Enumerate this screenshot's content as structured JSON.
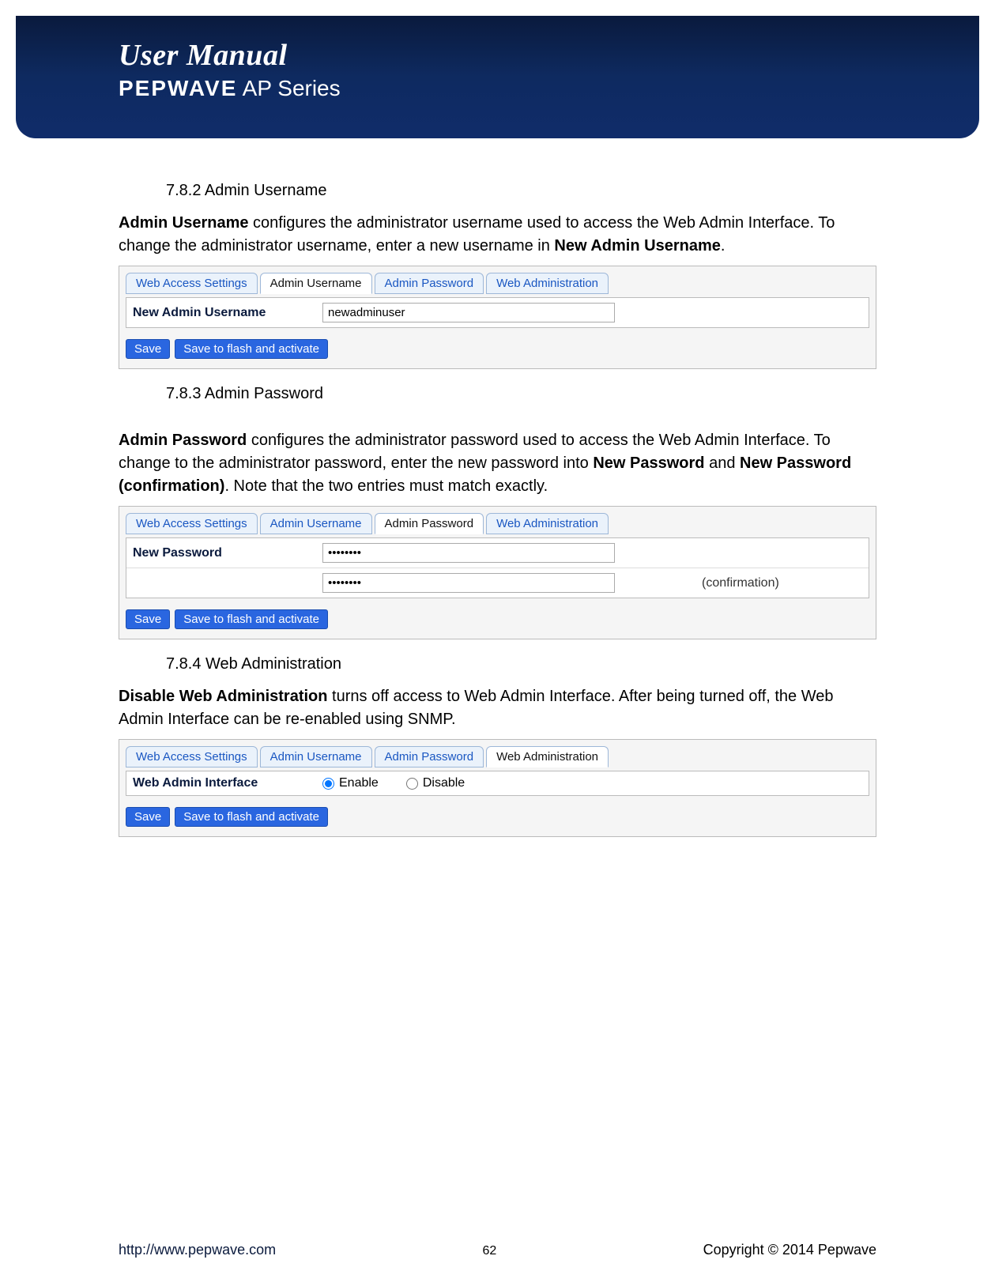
{
  "header": {
    "title": "User Manual",
    "brand": "PEPWAVE",
    "series": " AP Series"
  },
  "sections": {
    "s782": {
      "heading": "7.8.2 Admin Username",
      "para_prefix": "Admin Username",
      "para_mid1": " configures the administrator username used to access the Web Admin Interface. To change the administrator username, enter a new username in ",
      "para_bold2": "New Admin Username",
      "para_end": "."
    },
    "panel1": {
      "tabs": [
        "Web Access Settings",
        "Admin Username",
        "Admin Password",
        "Web Administration"
      ],
      "active": 1,
      "row_label": "New Admin Username",
      "row_value": "newadminuser",
      "save": "Save",
      "save_flash": "Save to flash and activate"
    },
    "s783": {
      "heading": "7.8.3 Admin Password",
      "para_prefix": "Admin Password",
      "para_mid1": " configures the administrator password used to access the Web Admin Interface. To change to the administrator password, enter the new password into ",
      "para_bold2": "New Password",
      "para_mid2": " and ",
      "para_bold3": "New Password (confirmation)",
      "para_end": ". Note that the two entries must match exactly."
    },
    "panel2": {
      "tabs": [
        "Web Access Settings",
        "Admin Username",
        "Admin Password",
        "Web Administration"
      ],
      "active": 2,
      "row_label": "New Password",
      "pw1": "••••••••",
      "pw2": "••••••••",
      "confirm_suffix": "(confirmation)",
      "save": "Save",
      "save_flash": "Save to flash and activate"
    },
    "s784": {
      "heading": "7.8.4   Web Administration",
      "para_prefix": "Disable Web Administration",
      "para_rest": " turns off access to Web Admin Interface. After being turned off, the Web Admin Interface can be re-enabled using SNMP."
    },
    "panel3": {
      "tabs": [
        "Web Access Settings",
        "Admin Username",
        "Admin Password",
        "Web Administration"
      ],
      "active": 3,
      "row_label": "Web Admin Interface",
      "opt_enable": "Enable",
      "opt_disable": "Disable",
      "enabled_checked": true,
      "save": "Save",
      "save_flash": "Save to flash and activate"
    }
  },
  "footer": {
    "url": "http://www.pepwave.com",
    "page": "62",
    "copyright": "Copyright  ©  2014  Pepwave"
  }
}
